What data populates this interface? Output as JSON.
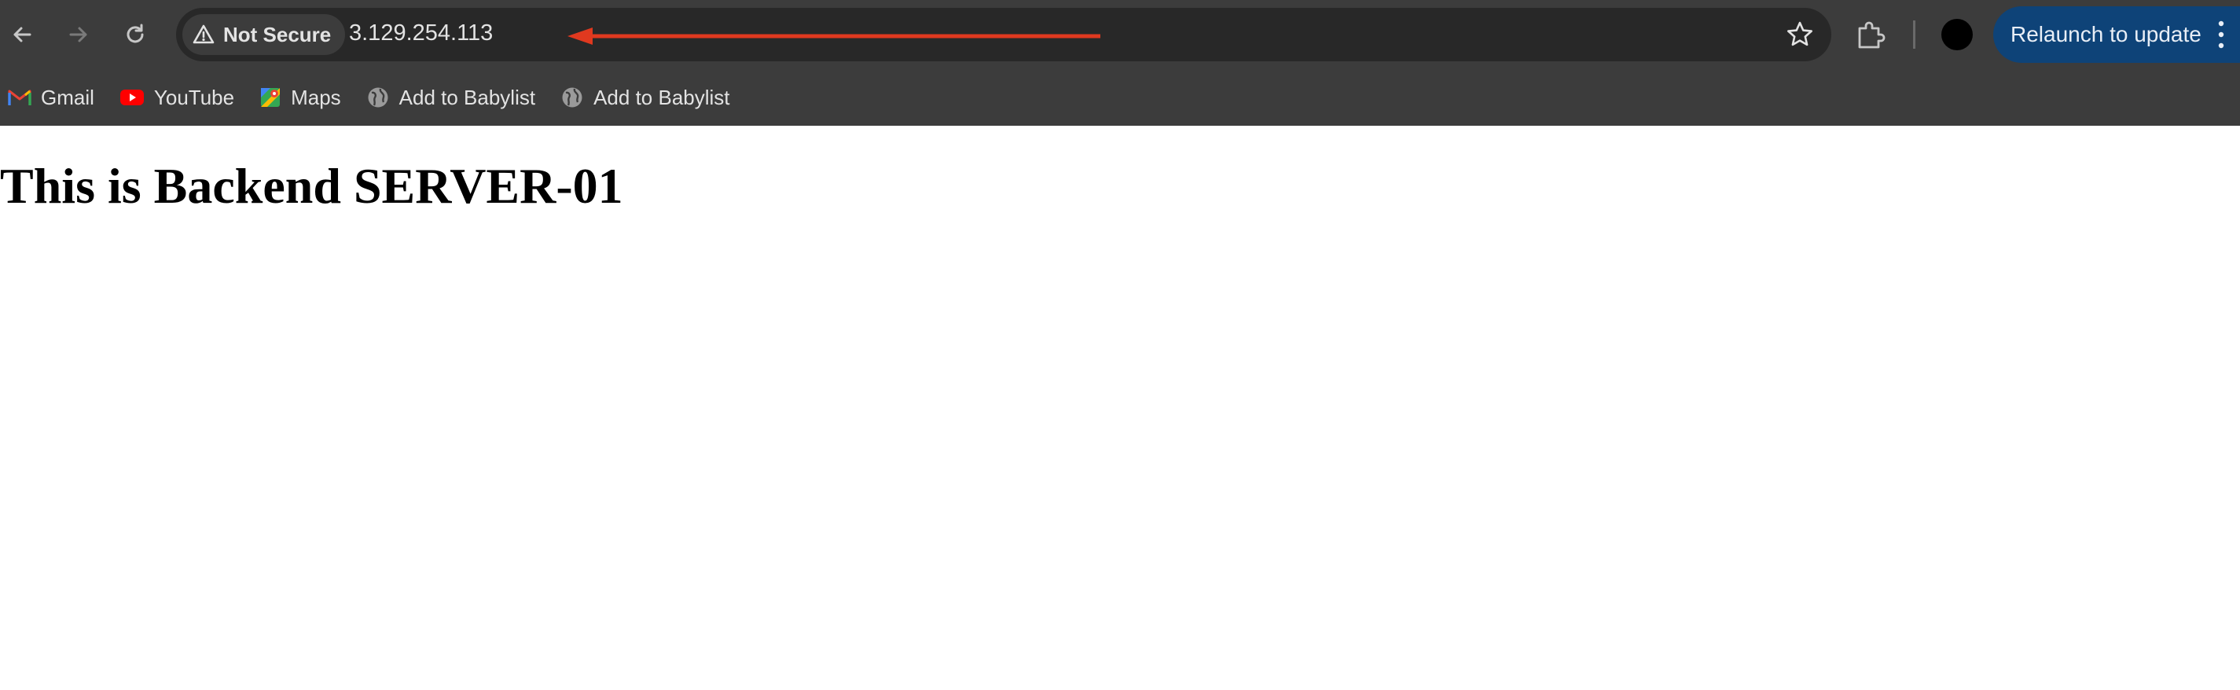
{
  "browser": {
    "security_chip": {
      "label": "Not Secure"
    },
    "address_bar": {
      "url": "3.129.254.113"
    },
    "relaunch_button": {
      "label": "Relaunch to update"
    },
    "bookmarks": [
      {
        "label": "Gmail",
        "icon": "gmail-icon"
      },
      {
        "label": "YouTube",
        "icon": "youtube-icon"
      },
      {
        "label": "Maps",
        "icon": "maps-icon"
      },
      {
        "label": "Add to Babylist",
        "icon": "globe-icon"
      },
      {
        "label": "Add to Babylist",
        "icon": "globe-icon"
      }
    ],
    "colors": {
      "toolbar": "#3c3c3c",
      "omnibox": "#282828",
      "relaunch": "#0e4378",
      "annotation_arrow": "#e0391f"
    }
  },
  "page": {
    "heading": "This is Backend SERVER-01"
  }
}
